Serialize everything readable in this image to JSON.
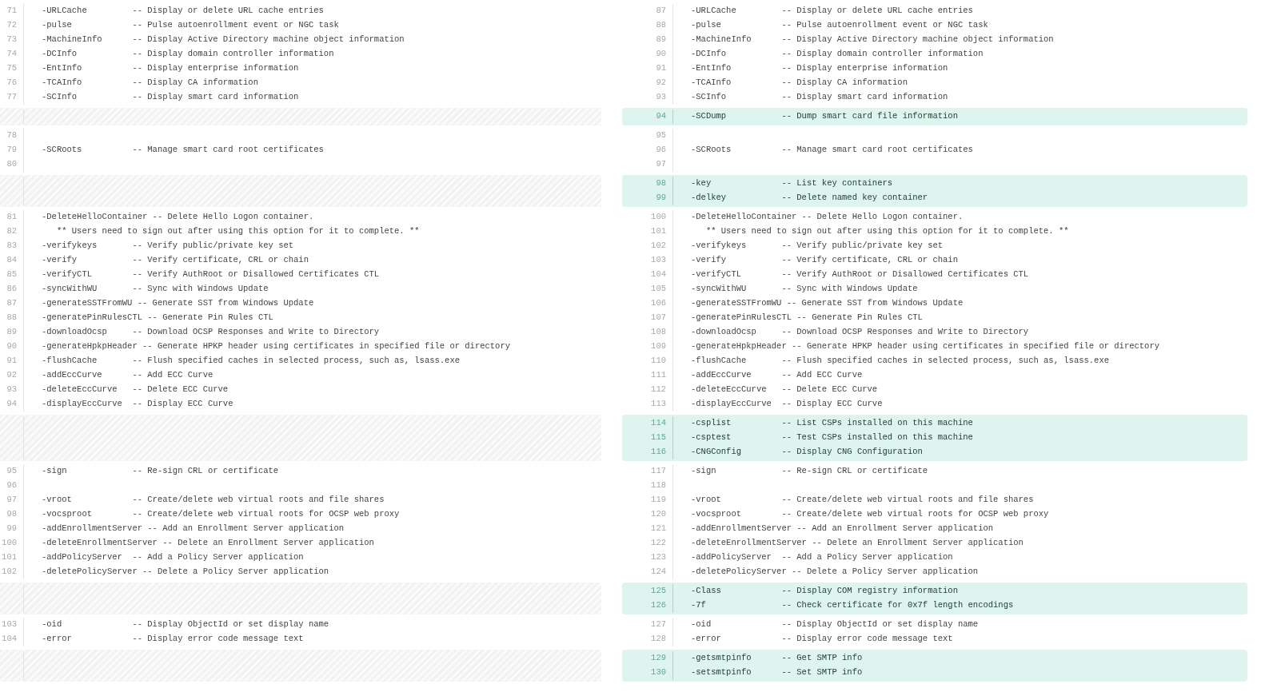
{
  "hunks": [
    {
      "kind": "same",
      "left": [
        {
          "n": "71",
          "t": "-URLCache         -- Display or delete URL cache entries"
        },
        {
          "n": "72",
          "t": "-pulse            -- Pulse autoenrollment event or NGC task"
        },
        {
          "n": "73",
          "t": "-MachineInfo      -- Display Active Directory machine object information"
        },
        {
          "n": "74",
          "t": "-DCInfo           -- Display domain controller information"
        },
        {
          "n": "75",
          "t": "-EntInfo          -- Display enterprise information"
        },
        {
          "n": "76",
          "t": "-TCAInfo          -- Display CA information"
        },
        {
          "n": "77",
          "t": "-SCInfo           -- Display smart card information"
        }
      ],
      "right": [
        {
          "n": "87",
          "t": "-URLCache         -- Display or delete URL cache entries"
        },
        {
          "n": "88",
          "t": "-pulse            -- Pulse autoenrollment event or NGC task"
        },
        {
          "n": "89",
          "t": "-MachineInfo      -- Display Active Directory machine object information"
        },
        {
          "n": "90",
          "t": "-DCInfo           -- Display domain controller information"
        },
        {
          "n": "91",
          "t": "-EntInfo          -- Display enterprise information"
        },
        {
          "n": "92",
          "t": "-TCAInfo          -- Display CA information"
        },
        {
          "n": "93",
          "t": "-SCInfo           -- Display smart card information"
        }
      ]
    },
    {
      "kind": "added",
      "right": [
        {
          "n": "94",
          "t": "-SCDump           -- Dump smart card file information"
        }
      ]
    },
    {
      "kind": "same",
      "left": [
        {
          "n": "78"
        },
        {
          "n": "79",
          "t": "-SCRoots          -- Manage smart card root certificates"
        },
        {
          "n": "80"
        }
      ],
      "right": [
        {
          "n": "95"
        },
        {
          "n": "96",
          "t": "-SCRoots          -- Manage smart card root certificates"
        },
        {
          "n": "97"
        }
      ]
    },
    {
      "kind": "added",
      "right": [
        {
          "n": "98",
          "t": "-key              -- List key containers"
        },
        {
          "n": "99",
          "t": "-delkey           -- Delete named key container"
        }
      ]
    },
    {
      "kind": "same",
      "left": [
        {
          "n": "81",
          "t": "-DeleteHelloContainer -- Delete Hello Logon container."
        },
        {
          "n": "82",
          "t": "   ** Users need to sign out after using this option for it to complete. **"
        },
        {
          "n": "83",
          "t": "-verifykeys       -- Verify public/private key set"
        },
        {
          "n": "84",
          "t": "-verify           -- Verify certificate, CRL or chain"
        },
        {
          "n": "85",
          "t": "-verifyCTL        -- Verify AuthRoot or Disallowed Certificates CTL"
        },
        {
          "n": "86",
          "t": "-syncWithWU       -- Sync with Windows Update"
        },
        {
          "n": "87",
          "t": "-generateSSTFromWU -- Generate SST from Windows Update"
        },
        {
          "n": "88",
          "t": "-generatePinRulesCTL -- Generate Pin Rules CTL"
        },
        {
          "n": "89",
          "t": "-downloadOcsp     -- Download OCSP Responses and Write to Directory"
        },
        {
          "n": "90",
          "t": "-generateHpkpHeader -- Generate HPKP header using certificates in specified file or directory"
        },
        {
          "n": "91",
          "t": "-flushCache       -- Flush specified caches in selected process, such as, lsass.exe"
        },
        {
          "n": "92",
          "t": "-addEccCurve      -- Add ECC Curve"
        },
        {
          "n": "93",
          "t": "-deleteEccCurve   -- Delete ECC Curve"
        },
        {
          "n": "94",
          "t": "-displayEccCurve  -- Display ECC Curve"
        }
      ],
      "right": [
        {
          "n": "100",
          "t": "-DeleteHelloContainer -- Delete Hello Logon container."
        },
        {
          "n": "101",
          "t": "   ** Users need to sign out after using this option for it to complete. **"
        },
        {
          "n": "102",
          "t": "-verifykeys       -- Verify public/private key set"
        },
        {
          "n": "103",
          "t": "-verify           -- Verify certificate, CRL or chain"
        },
        {
          "n": "104",
          "t": "-verifyCTL        -- Verify AuthRoot or Disallowed Certificates CTL"
        },
        {
          "n": "105",
          "t": "-syncWithWU       -- Sync with Windows Update"
        },
        {
          "n": "106",
          "t": "-generateSSTFromWU -- Generate SST from Windows Update"
        },
        {
          "n": "107",
          "t": "-generatePinRulesCTL -- Generate Pin Rules CTL"
        },
        {
          "n": "108",
          "t": "-downloadOcsp     -- Download OCSP Responses and Write to Directory"
        },
        {
          "n": "109",
          "t": "-generateHpkpHeader -- Generate HPKP header using certificates in specified file or directory"
        },
        {
          "n": "110",
          "t": "-flushCache       -- Flush specified caches in selected process, such as, lsass.exe"
        },
        {
          "n": "111",
          "t": "-addEccCurve      -- Add ECC Curve"
        },
        {
          "n": "112",
          "t": "-deleteEccCurve   -- Delete ECC Curve"
        },
        {
          "n": "113",
          "t": "-displayEccCurve  -- Display ECC Curve"
        }
      ]
    },
    {
      "kind": "added",
      "right": [
        {
          "n": "114",
          "t": "-csplist          -- List CSPs installed on this machine"
        },
        {
          "n": "115",
          "t": "-csptest          -- Test CSPs installed on this machine"
        },
        {
          "n": "116",
          "t": "-CNGConfig        -- Display CNG Configuration"
        }
      ]
    },
    {
      "kind": "same",
      "left": [
        {
          "n": "95",
          "t": "-sign             -- Re-sign CRL or certificate"
        },
        {
          "n": "96"
        },
        {
          "n": "97",
          "t": "-vroot            -- Create/delete web virtual roots and file shares"
        },
        {
          "n": "98",
          "t": "-vocsproot        -- Create/delete web virtual roots for OCSP web proxy"
        },
        {
          "n": "99",
          "t": "-addEnrollmentServer -- Add an Enrollment Server application"
        },
        {
          "n": "100",
          "t": "-deleteEnrollmentServer -- Delete an Enrollment Server application"
        },
        {
          "n": "101",
          "t": "-addPolicyServer  -- Add a Policy Server application"
        },
        {
          "n": "102",
          "t": "-deletePolicyServer -- Delete a Policy Server application"
        }
      ],
      "right": [
        {
          "n": "117",
          "t": "-sign             -- Re-sign CRL or certificate"
        },
        {
          "n": "118"
        },
        {
          "n": "119",
          "t": "-vroot            -- Create/delete web virtual roots and file shares"
        },
        {
          "n": "120",
          "t": "-vocsproot        -- Create/delete web virtual roots for OCSP web proxy"
        },
        {
          "n": "121",
          "t": "-addEnrollmentServer -- Add an Enrollment Server application"
        },
        {
          "n": "122",
          "t": "-deleteEnrollmentServer -- Delete an Enrollment Server application"
        },
        {
          "n": "123",
          "t": "-addPolicyServer  -- Add a Policy Server application"
        },
        {
          "n": "124",
          "t": "-deletePolicyServer -- Delete a Policy Server application"
        }
      ]
    },
    {
      "kind": "added",
      "right": [
        {
          "n": "125",
          "t": "-Class            -- Display COM registry information"
        },
        {
          "n": "126",
          "t": "-7f               -- Check certificate for 0x7f length encodings"
        }
      ]
    },
    {
      "kind": "same",
      "left": [
        {
          "n": "103",
          "t": "-oid              -- Display ObjectId or set display name"
        },
        {
          "n": "104",
          "t": "-error            -- Display error code message text"
        }
      ],
      "right": [
        {
          "n": "127",
          "t": "-oid              -- Display ObjectId or set display name"
        },
        {
          "n": "128",
          "t": "-error            -- Display error code message text"
        }
      ]
    },
    {
      "kind": "added",
      "right": [
        {
          "n": "129",
          "t": "-getsmtpinfo      -- Get SMTP info"
        },
        {
          "n": "130",
          "t": "-setsmtpinfo      -- Set SMTP info"
        }
      ]
    }
  ]
}
